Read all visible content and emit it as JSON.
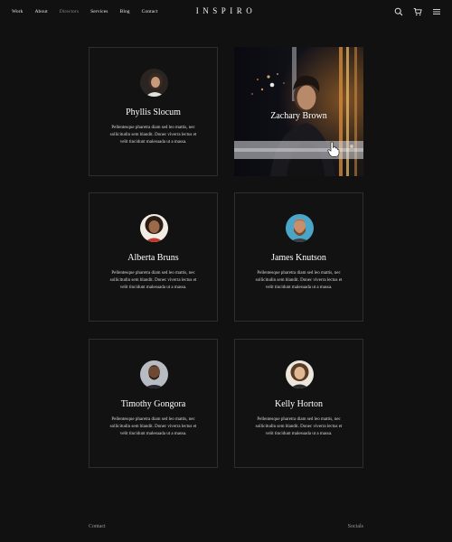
{
  "nav": {
    "items": [
      {
        "label": "Work",
        "active": false
      },
      {
        "label": "About",
        "active": false
      },
      {
        "label": "Directors",
        "active": true
      },
      {
        "label": "Services",
        "active": false
      },
      {
        "label": "Blog",
        "active": false
      },
      {
        "label": "Contact",
        "active": false
      }
    ]
  },
  "brand": {
    "logo": "INSPIRO"
  },
  "header_icons": [
    "search-icon",
    "cart-icon",
    "menu-icon"
  ],
  "directors": [
    {
      "name": "Phyllis Slocum",
      "bio": "Pellentesque pharetra diam sed leo mattis, nec sollicitudin sem blandit. Donec viverra lectus et velit tincidunt malesuada ut a massa."
    },
    {
      "name": "Zachary Brown",
      "hovered": true
    },
    {
      "name": "Alberta Bruns",
      "bio": "Pellentesque pharetra diam sed leo mattis, nec sollicitudin sem blandit. Donec viverra lectus et velit tincidunt malesuada ut a massa."
    },
    {
      "name": "James Knutson",
      "bio": "Pellentesque pharetra diam sed leo mattis, nec sollicitudin sem blandit. Donec viverra lectus et velit tincidunt malesuada ut a massa."
    },
    {
      "name": "Timothy Gongora",
      "bio": "Pellentesque pharetra diam sed leo mattis, nec sollicitudin sem blandit. Donec viverra lectus et velit tincidunt malesuada ut a massa."
    },
    {
      "name": "Kelly Horton",
      "bio": "Pellentesque pharetra diam sed leo mattis, nec sollicitudin sem blandit. Donec viverra lectus et velit tincidunt malesuada ut a massa."
    }
  ],
  "footer": {
    "contact_label": "Contact",
    "socials_label": "Socials"
  },
  "colors": {
    "background": "#111111",
    "card_border": "#2e2e2e",
    "text": "#ffffff",
    "active_nav": "#8a8a8a"
  }
}
